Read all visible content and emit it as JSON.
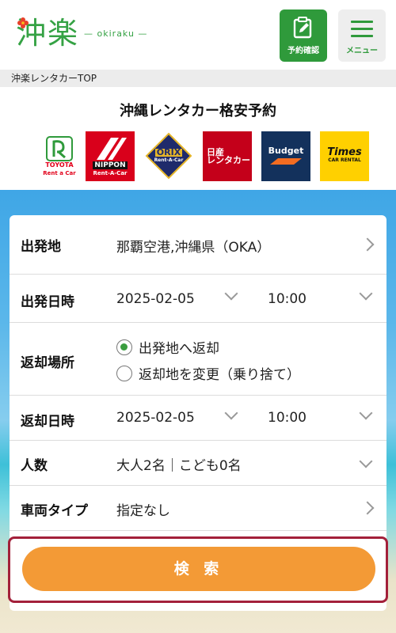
{
  "header": {
    "logo_text": "沖楽",
    "logo_sub": "— okiraku —",
    "reserve_label": "予約確認",
    "menu_label": "メニュー"
  },
  "breadcrumb": "沖楽レンタカーTOP",
  "title": "沖縄レンタカー格安予約",
  "companies": [
    {
      "name": "TOYOTA",
      "sub": "Rent a Car"
    },
    {
      "name": "NIPPON",
      "sub": "Rent-A-Car"
    },
    {
      "name": "ORIX",
      "sub": "Rent-A-Car"
    },
    {
      "name": "日産",
      "sub": "レンタカー"
    },
    {
      "name": "Budget",
      "sub": ""
    },
    {
      "name": "Times",
      "sub": "CAR RENTAL"
    }
  ],
  "form": {
    "departure": {
      "label": "出発地",
      "value": "那覇空港,沖縄県（OKA）"
    },
    "departure_datetime": {
      "label": "出発日時",
      "date": "2025-02-05",
      "time": "10:00"
    },
    "return_place": {
      "label": "返却場所",
      "option1": "出発地へ返却",
      "option2": "返却地を変更（乗り捨て）"
    },
    "return_datetime": {
      "label": "返却日時",
      "date": "2025-02-05",
      "time": "10:00"
    },
    "people": {
      "label": "人数",
      "value": "大人2名｜こども0名"
    },
    "car_type": {
      "label": "車両タイプ",
      "value": "指定なし"
    },
    "search_label": "検 索"
  },
  "colors": {
    "brand_green": "#2f9a3b",
    "accent_orange": "#f39a36",
    "highlight_border": "#a3203a"
  }
}
